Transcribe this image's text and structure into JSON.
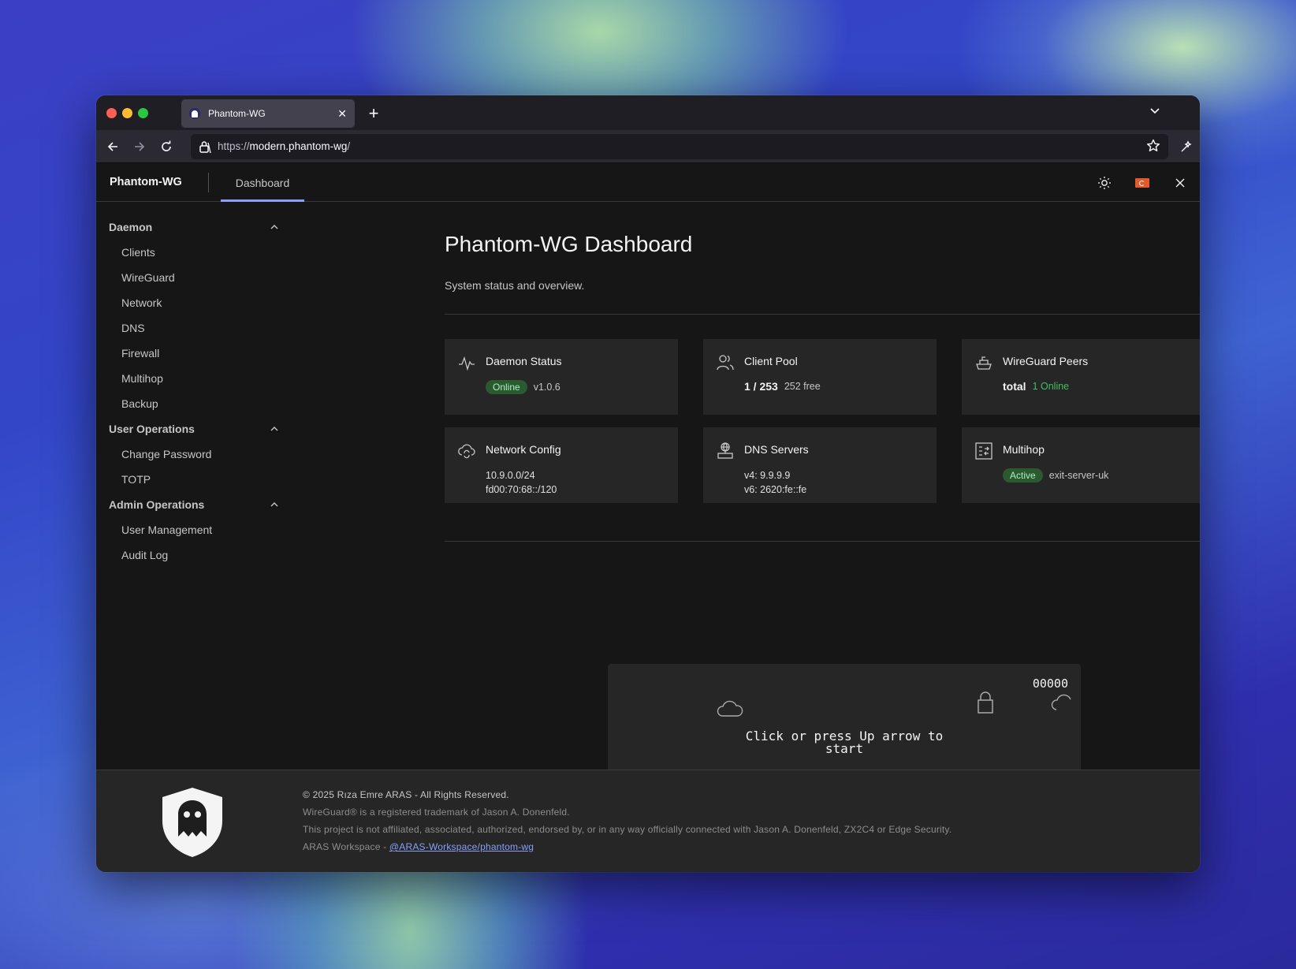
{
  "browser": {
    "tab_title": "Phantom-WG",
    "url_scheme": "https://",
    "url_host": "modern.phantom-wg",
    "url_path": "/"
  },
  "header": {
    "brand": "Phantom-WG",
    "active_tab": "Dashboard"
  },
  "sidebar": {
    "groups": [
      {
        "label": "Daemon",
        "items": [
          "Clients",
          "WireGuard",
          "Network",
          "DNS",
          "Firewall",
          "Multihop",
          "Backup"
        ]
      },
      {
        "label": "User Operations",
        "items": [
          "Change Password",
          "TOTP"
        ]
      },
      {
        "label": "Admin Operations",
        "items": [
          "User Management",
          "Audit Log"
        ]
      }
    ]
  },
  "main": {
    "title": "Phantom-WG Dashboard",
    "subtitle": "System status and overview.",
    "cards": {
      "daemon": {
        "title": "Daemon Status",
        "badge": "Online",
        "version": "v1.0.6"
      },
      "pool": {
        "title": "Client Pool",
        "count": "1 / 253",
        "free": "252 free"
      },
      "peers": {
        "title": "WireGuard Peers",
        "total": "total",
        "online": "1 Online"
      },
      "network": {
        "title": "Network Config",
        "v4": "10.9.0.0/24",
        "v6": "fd00:70:68::/120"
      },
      "dns": {
        "title": "DNS Servers",
        "v4": "v4: 9.9.9.9",
        "v6": "v6: 2620:fe::fe"
      },
      "multihop": {
        "title": "Multihop",
        "badge": "Active",
        "exit": "exit-server-uk"
      }
    },
    "game": {
      "score": "00000",
      "message": "Click or press Up arrow to start"
    }
  },
  "footer": {
    "copyright": "© 2025 Rıza Emre ARAS - All Rights Reserved.",
    "trademark": "WireGuard® is a registered trademark of Jason A. Donenfeld.",
    "disclaimer": "This project is not affiliated, associated, authorized, endorsed by, or in any way officially connected with Jason A. Donenfeld, ZX2C4 or Edge Security.",
    "workspace_prefix": "ARAS Workspace - ",
    "workspace_link": "@ARAS-Workspace/phantom-wg"
  },
  "colors": {
    "accent": "#8a9ff7",
    "success": "#42be65",
    "badge_bg": "#2c5a30"
  }
}
